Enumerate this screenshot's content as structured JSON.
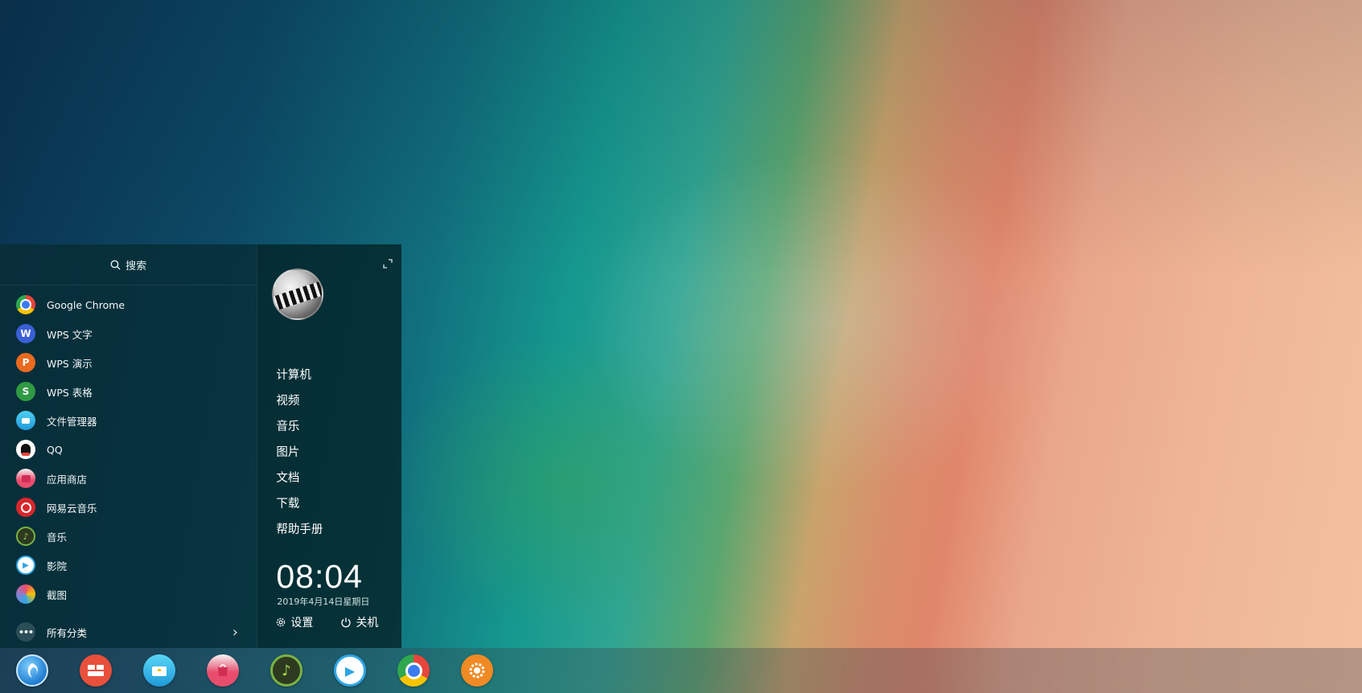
{
  "search": {
    "label": "搜索"
  },
  "apps": [
    {
      "label": "Google Chrome",
      "icon": "chrome-icon",
      "color": "#e8453c"
    },
    {
      "label": "WPS 文字",
      "icon": "wps-writer-icon",
      "color": "#3b5fd6",
      "glyph": "W"
    },
    {
      "label": "WPS 演示",
      "icon": "wps-presentation-icon",
      "color": "#ea6a1f",
      "glyph": "P"
    },
    {
      "label": "WPS 表格",
      "icon": "wps-spreadsheet-icon",
      "color": "#2f9a43",
      "glyph": "S"
    },
    {
      "label": "文件管理器",
      "icon": "file-manager-icon",
      "color": "#2ab3e6"
    },
    {
      "label": "QQ",
      "icon": "qq-icon",
      "color": "#ffffff"
    },
    {
      "label": "应用商店",
      "icon": "app-store-icon",
      "color": "#e94d6d"
    },
    {
      "label": "网易云音乐",
      "icon": "netease-music-icon",
      "color": "#d8272c"
    },
    {
      "label": "音乐",
      "icon": "music-icon",
      "color": "#7ab342"
    },
    {
      "label": "影院",
      "icon": "movie-icon",
      "color": "#2fa6e6"
    },
    {
      "label": "截图",
      "icon": "screenshot-icon",
      "color": "#8a7fd0"
    }
  ],
  "all_categories": {
    "label": "所有分类",
    "chevron": "›"
  },
  "places": [
    "计算机",
    "视频",
    "音乐",
    "图片",
    "文档",
    "下载",
    "帮助手册"
  ],
  "clock": {
    "time": "08:04",
    "date": "2019年4月14日星期日"
  },
  "actions": {
    "settings": "设置",
    "power": "关机"
  },
  "dock": [
    {
      "icon": "launcher-icon",
      "color": "#2a8ad8"
    },
    {
      "icon": "multitask-view-icon",
      "color": "#e8503c"
    },
    {
      "icon": "file-manager-icon",
      "color": "#2ab3e6"
    },
    {
      "icon": "app-store-icon",
      "color": "#e94d6d"
    },
    {
      "icon": "music-icon",
      "color": "#6fae3a"
    },
    {
      "icon": "movie-icon",
      "color": "#2fa6e6"
    },
    {
      "icon": "chrome-icon",
      "color": "#e8453c"
    },
    {
      "icon": "settings-icon",
      "color": "#f08a24"
    }
  ]
}
